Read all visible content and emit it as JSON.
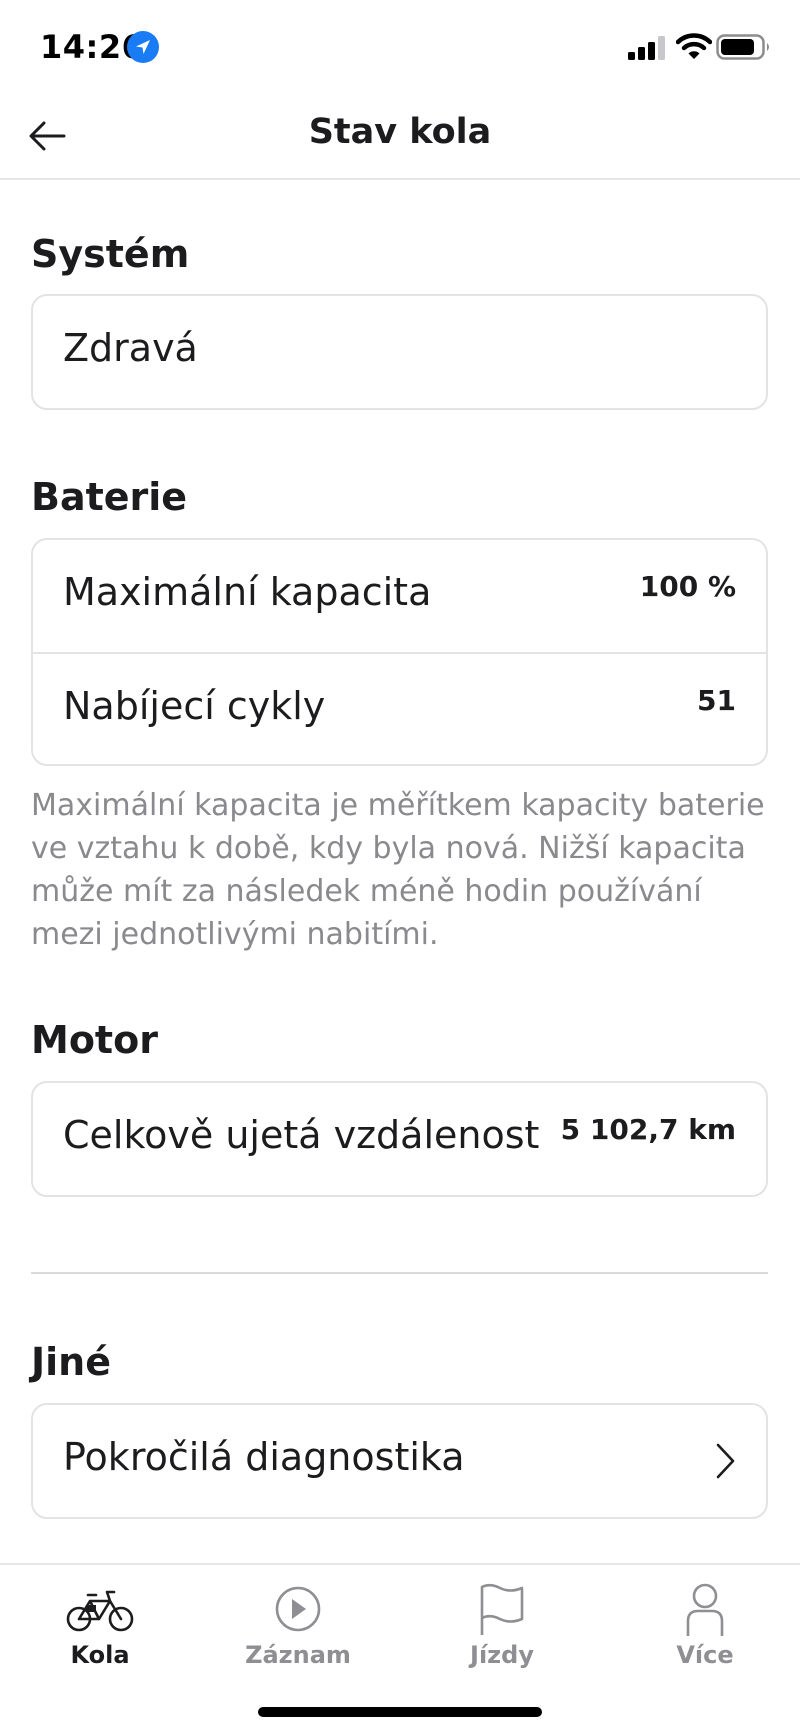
{
  "status_bar": {
    "time": "14:26"
  },
  "header": {
    "title": "Stav kola"
  },
  "sections": {
    "system": {
      "title": "Systém",
      "status": "Zdravá"
    },
    "battery": {
      "title": "Baterie",
      "rows": [
        {
          "label": "Maximální kapacita",
          "value": "100 %"
        },
        {
          "label": "Nabíjecí cykly",
          "value": "51"
        }
      ],
      "footnote": "Maximální kapacita je měřítkem kapacity baterie ve vztahu k době, kdy byla nová. Nižší kapacita může mít za následek méně hodin používání mezi jednotlivými nabitími."
    },
    "motor": {
      "title": "Motor",
      "rows": [
        {
          "label": "Celkově ujetá vzdálenost",
          "value": "5 102,7 km"
        }
      ]
    },
    "other": {
      "title": "Jiné",
      "rows": [
        {
          "label": "Pokročilá diagnostika"
        }
      ]
    }
  },
  "tab_bar": {
    "tabs": [
      {
        "label": "Kola",
        "icon": "bike-icon",
        "active": true
      },
      {
        "label": "Záznam",
        "icon": "play-icon",
        "active": false
      },
      {
        "label": "Jízdy",
        "icon": "flag-icon",
        "active": false
      },
      {
        "label": "Více",
        "icon": "person-icon",
        "active": false
      }
    ]
  },
  "colors": {
    "location": "#1a7cf5",
    "muted": "#8e8e93",
    "text": "#1c1c1e"
  }
}
